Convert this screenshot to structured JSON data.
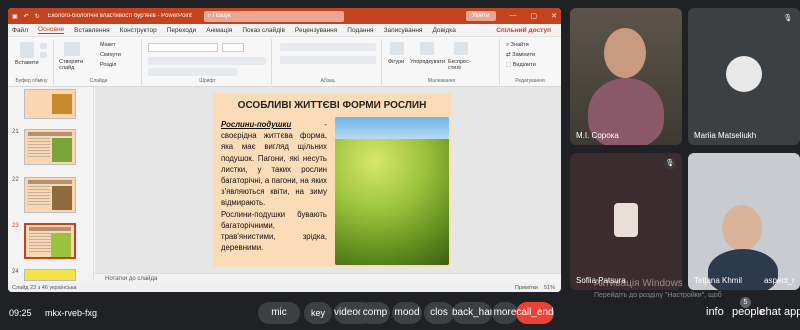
{
  "powerpoint": {
    "title": "Еколого-біологічні властивості бур'янів - PowerPoint",
    "search_placeholder": "Пошук",
    "enter_button": "Увійти",
    "menu": [
      "Файл",
      "Основне",
      "Вставлення",
      "Конструктор",
      "Переходи",
      "Анімація",
      "Показ слайдів",
      "Рецензування",
      "Подання",
      "Записування",
      "Довідка"
    ],
    "share_label": "Спільний доступ",
    "ribbon": {
      "paste_label": "Вставити",
      "clipboard_group": "Буфер обміну",
      "new_slide_label": "Створити слайд",
      "layout_label": "Макет",
      "reset_label": "Скинути",
      "section_label": "Розділ",
      "slides_group": "Слайди",
      "font_group": "Шрифт",
      "paragraph_group": "Абзац",
      "shapes_label": "Фігури",
      "arrange_label": "Упорядкувати",
      "quick_styles_label": "Експрес-стилі",
      "drawing_group": "Малювання",
      "find_label": "Знайти",
      "replace_label": "Замінити",
      "select_label": "Виділити",
      "editing_group": "Редагування"
    },
    "thumbnails": [
      {
        "num": "21"
      },
      {
        "num": "22"
      },
      {
        "num": "23"
      },
      {
        "num": "24"
      }
    ],
    "slide": {
      "title": "ОСОБЛИВІ ЖИТТЄВІ ФОРМИ РОСЛИН",
      "term": "Рослини-подушки",
      "body1": " - своєрідна життєва форма, яка має вигляд щільних подушок. Пагони, які несуть листки, у таких рослин багаторічні, а пагони, на яких з'являються квіти, на зиму відмирають.",
      "body2": "Рослини-подушки бувають багаторічними, трав'янистими, зрідка, деревними."
    },
    "notes_label": "Нотатки до слайда",
    "status_left": "Слайд 23 з 46   українська",
    "status_notes": "Примітки",
    "status_zoom": "51%"
  },
  "participants": [
    {
      "name": "M.I. Сорока"
    },
    {
      "name": "Mariia Matseliukh"
    },
    {
      "name": "Soflia Patsura"
    },
    {
      "name": "Tetjana Khmil"
    }
  ],
  "extra_name": "aspect_r",
  "windows_watermark": {
    "line1": "Активація Windows",
    "line2": "Перейдіть до розділу \"Настройки\", щоб активувати Windows."
  },
  "bottombar": {
    "time": "09:25",
    "meeting_code": "mkx-rveb-fxg",
    "controls": [
      "mic",
      "key",
      "videocam",
      "comp",
      "mood",
      "clos",
      "back_hand",
      "more",
      "call_end"
    ],
    "right_controls": [
      "info",
      "people",
      "chat",
      "apps"
    ],
    "people_count": "5"
  },
  "colors": {
    "ppt_accent": "#c4431f",
    "slide_bg": "#fbdcb9",
    "end_call": "#ea4335"
  }
}
